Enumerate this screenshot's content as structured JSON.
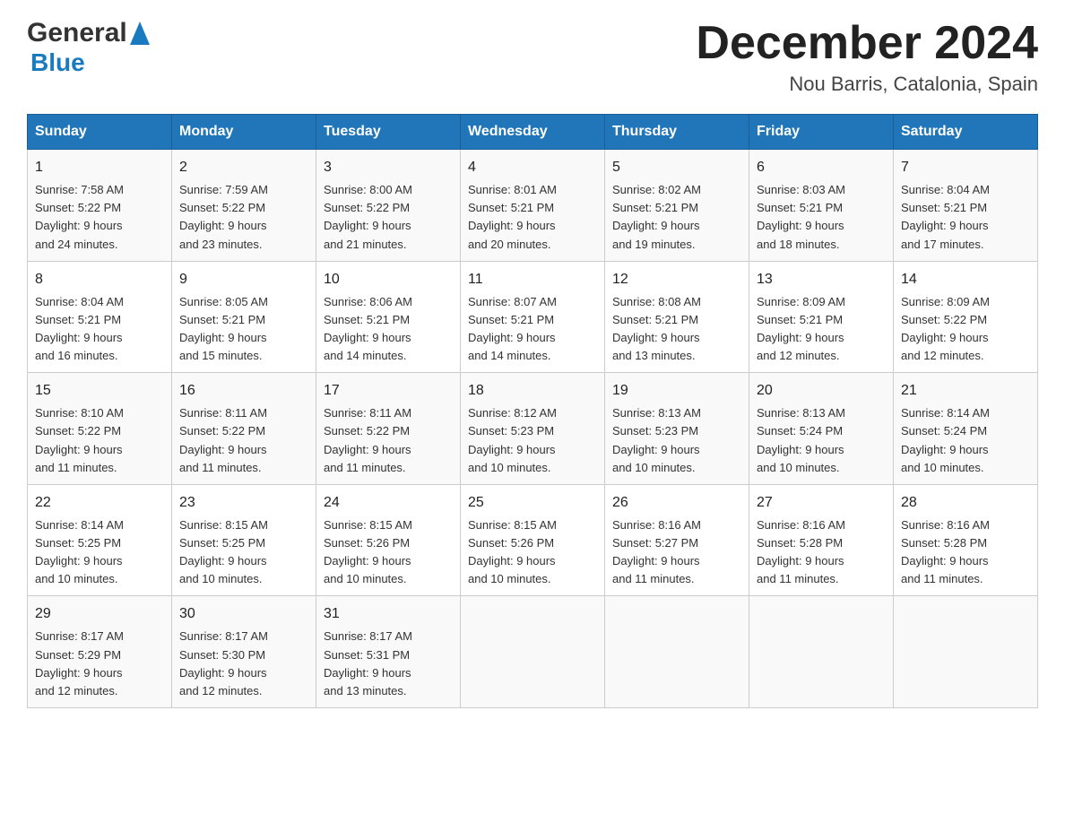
{
  "header": {
    "logo_general": "General",
    "logo_blue": "Blue",
    "month_title": "December 2024",
    "location": "Nou Barris, Catalonia, Spain"
  },
  "columns": [
    "Sunday",
    "Monday",
    "Tuesday",
    "Wednesday",
    "Thursday",
    "Friday",
    "Saturday"
  ],
  "weeks": [
    [
      {
        "day": "1",
        "info": "Sunrise: 7:58 AM\nSunset: 5:22 PM\nDaylight: 9 hours\nand 24 minutes."
      },
      {
        "day": "2",
        "info": "Sunrise: 7:59 AM\nSunset: 5:22 PM\nDaylight: 9 hours\nand 23 minutes."
      },
      {
        "day": "3",
        "info": "Sunrise: 8:00 AM\nSunset: 5:22 PM\nDaylight: 9 hours\nand 21 minutes."
      },
      {
        "day": "4",
        "info": "Sunrise: 8:01 AM\nSunset: 5:21 PM\nDaylight: 9 hours\nand 20 minutes."
      },
      {
        "day": "5",
        "info": "Sunrise: 8:02 AM\nSunset: 5:21 PM\nDaylight: 9 hours\nand 19 minutes."
      },
      {
        "day": "6",
        "info": "Sunrise: 8:03 AM\nSunset: 5:21 PM\nDaylight: 9 hours\nand 18 minutes."
      },
      {
        "day": "7",
        "info": "Sunrise: 8:04 AM\nSunset: 5:21 PM\nDaylight: 9 hours\nand 17 minutes."
      }
    ],
    [
      {
        "day": "8",
        "info": "Sunrise: 8:04 AM\nSunset: 5:21 PM\nDaylight: 9 hours\nand 16 minutes."
      },
      {
        "day": "9",
        "info": "Sunrise: 8:05 AM\nSunset: 5:21 PM\nDaylight: 9 hours\nand 15 minutes."
      },
      {
        "day": "10",
        "info": "Sunrise: 8:06 AM\nSunset: 5:21 PM\nDaylight: 9 hours\nand 14 minutes."
      },
      {
        "day": "11",
        "info": "Sunrise: 8:07 AM\nSunset: 5:21 PM\nDaylight: 9 hours\nand 14 minutes."
      },
      {
        "day": "12",
        "info": "Sunrise: 8:08 AM\nSunset: 5:21 PM\nDaylight: 9 hours\nand 13 minutes."
      },
      {
        "day": "13",
        "info": "Sunrise: 8:09 AM\nSunset: 5:21 PM\nDaylight: 9 hours\nand 12 minutes."
      },
      {
        "day": "14",
        "info": "Sunrise: 8:09 AM\nSunset: 5:22 PM\nDaylight: 9 hours\nand 12 minutes."
      }
    ],
    [
      {
        "day": "15",
        "info": "Sunrise: 8:10 AM\nSunset: 5:22 PM\nDaylight: 9 hours\nand 11 minutes."
      },
      {
        "day": "16",
        "info": "Sunrise: 8:11 AM\nSunset: 5:22 PM\nDaylight: 9 hours\nand 11 minutes."
      },
      {
        "day": "17",
        "info": "Sunrise: 8:11 AM\nSunset: 5:22 PM\nDaylight: 9 hours\nand 11 minutes."
      },
      {
        "day": "18",
        "info": "Sunrise: 8:12 AM\nSunset: 5:23 PM\nDaylight: 9 hours\nand 10 minutes."
      },
      {
        "day": "19",
        "info": "Sunrise: 8:13 AM\nSunset: 5:23 PM\nDaylight: 9 hours\nand 10 minutes."
      },
      {
        "day": "20",
        "info": "Sunrise: 8:13 AM\nSunset: 5:24 PM\nDaylight: 9 hours\nand 10 minutes."
      },
      {
        "day": "21",
        "info": "Sunrise: 8:14 AM\nSunset: 5:24 PM\nDaylight: 9 hours\nand 10 minutes."
      }
    ],
    [
      {
        "day": "22",
        "info": "Sunrise: 8:14 AM\nSunset: 5:25 PM\nDaylight: 9 hours\nand 10 minutes."
      },
      {
        "day": "23",
        "info": "Sunrise: 8:15 AM\nSunset: 5:25 PM\nDaylight: 9 hours\nand 10 minutes."
      },
      {
        "day": "24",
        "info": "Sunrise: 8:15 AM\nSunset: 5:26 PM\nDaylight: 9 hours\nand 10 minutes."
      },
      {
        "day": "25",
        "info": "Sunrise: 8:15 AM\nSunset: 5:26 PM\nDaylight: 9 hours\nand 10 minutes."
      },
      {
        "day": "26",
        "info": "Sunrise: 8:16 AM\nSunset: 5:27 PM\nDaylight: 9 hours\nand 11 minutes."
      },
      {
        "day": "27",
        "info": "Sunrise: 8:16 AM\nSunset: 5:28 PM\nDaylight: 9 hours\nand 11 minutes."
      },
      {
        "day": "28",
        "info": "Sunrise: 8:16 AM\nSunset: 5:28 PM\nDaylight: 9 hours\nand 11 minutes."
      }
    ],
    [
      {
        "day": "29",
        "info": "Sunrise: 8:17 AM\nSunset: 5:29 PM\nDaylight: 9 hours\nand 12 minutes."
      },
      {
        "day": "30",
        "info": "Sunrise: 8:17 AM\nSunset: 5:30 PM\nDaylight: 9 hours\nand 12 minutes."
      },
      {
        "day": "31",
        "info": "Sunrise: 8:17 AM\nSunset: 5:31 PM\nDaylight: 9 hours\nand 13 minutes."
      },
      {
        "day": "",
        "info": ""
      },
      {
        "day": "",
        "info": ""
      },
      {
        "day": "",
        "info": ""
      },
      {
        "day": "",
        "info": ""
      }
    ]
  ]
}
